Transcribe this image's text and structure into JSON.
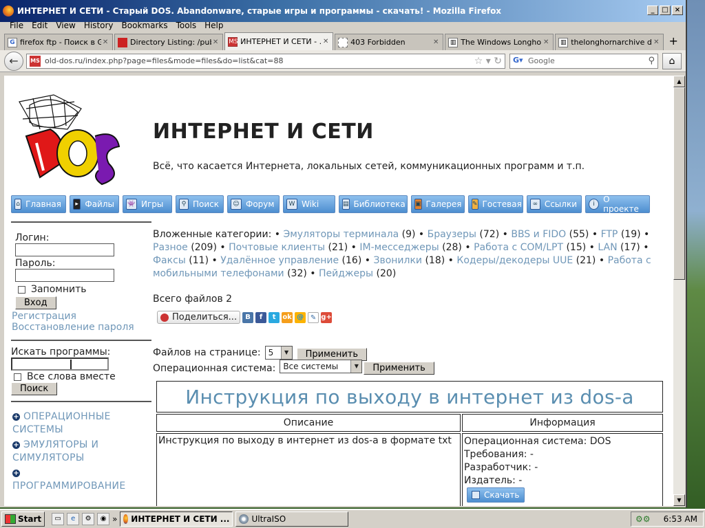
{
  "window": {
    "title": "ИНТЕРНЕТ И СЕТИ - Старый DOS. Abandonware, старые игры и программы - скачать! - Mozilla Firefox"
  },
  "menu": [
    "File",
    "Edit",
    "View",
    "History",
    "Bookmarks",
    "Tools",
    "Help"
  ],
  "tabs": [
    {
      "label": "firefox ftp - Поиск в G...",
      "icon": "google-icon"
    },
    {
      "label": "Directory Listing: /pub/...",
      "icon": "red-bird-icon"
    },
    {
      "label": "ИНТЕРНЕТ И СЕТИ - ...",
      "icon": "msdos-icon",
      "active": true
    },
    {
      "label": "403 Forbidden",
      "icon": "blank-page-icon"
    },
    {
      "label": "The Windows Longhor...",
      "icon": "page-icon"
    },
    {
      "label": "thelonghornarchive dir...",
      "icon": "page-icon"
    }
  ],
  "nav": {
    "url": "old-dos.ru/index.php?page=files&mode=files&do=list&cat=88",
    "search_placeholder": "Google"
  },
  "site": {
    "title": "ИНТЕРНЕТ И СЕТИ",
    "subtitle": "Всё, что касается Интернета, локальных сетей, коммуникационных программ и т.п.",
    "logo_text": "MS DOS"
  },
  "topnav": [
    "Главная",
    "Файлы",
    "Игры",
    "Поиск",
    "Форум",
    "Wiki",
    "Библиотека",
    "Галерея",
    "Гостевая",
    "Ссылки",
    "О проекте"
  ],
  "sidebar": {
    "login_label": "Логин:",
    "password_label": "Пароль:",
    "remember_label": "Запомнить",
    "login_button": "Вход",
    "register_link": "Регистрация",
    "restore_link": "Восстановление пароля",
    "search_label": "Искать программы:",
    "all_words_label": "Все слова вместе",
    "search_button": "Поиск",
    "categories": [
      "ОПЕРАЦИОННЫЕ СИСТЕМЫ",
      "ЭМУЛЯТОРЫ И СИМУЛЯТОРЫ",
      "ПРОГРАММИРОВАНИЕ"
    ]
  },
  "main": {
    "subcats_label": "Вложенные категории:",
    "subcats": [
      {
        "name": "Эмуляторы терминала",
        "count": "(9)"
      },
      {
        "name": "Браузеры",
        "count": "(72)"
      },
      {
        "name": "BBS и FIDO",
        "count": "(55)"
      },
      {
        "name": "FTP",
        "count": "(19)"
      },
      {
        "name": "Разное",
        "count": "(209)"
      },
      {
        "name": "Почтовые клиенты",
        "count": "(21)"
      },
      {
        "name": "IM-месседжеры",
        "count": "(28)"
      },
      {
        "name": "Работа с COM/LPT",
        "count": "(15)"
      },
      {
        "name": "LAN",
        "count": "(17)"
      },
      {
        "name": "Факсы",
        "count": "(11)"
      },
      {
        "name": "Удалённое управление",
        "count": "(16)"
      },
      {
        "name": "Звонилки",
        "count": "(18)"
      },
      {
        "name": "Кодеры/декодеры UUE",
        "count": "(21)"
      },
      {
        "name": "Работа с мобильными телефонами",
        "count": "(32)"
      },
      {
        "name": "Пейджеры",
        "count": "(20)"
      }
    ],
    "total_files": "Всего файлов 2",
    "share_button": "Поделиться...",
    "per_page_label": "Файлов на странице:",
    "per_page_value": "5",
    "apply_button": "Применить",
    "os_label": "Операционная система:",
    "os_value": "Все системы",
    "file": {
      "title": "Инструкция по выходу в интернет из dos-а",
      "col_desc": "Описание",
      "col_info": "Информация",
      "desc": "Инструкция по выходу в интернет из dos-а в формате txt",
      "info": [
        "Операционная система: DOS",
        "Требования: -",
        "Разработчик: -",
        "Издатель: -"
      ],
      "download": "Скачать"
    }
  },
  "taskbar": {
    "start": "Start",
    "buttons": [
      {
        "label": "ИНТЕРНЕТ И СЕТИ ...",
        "active": true
      },
      {
        "label": "UltraISO",
        "active": false
      }
    ],
    "clock": "6:53 AM"
  }
}
